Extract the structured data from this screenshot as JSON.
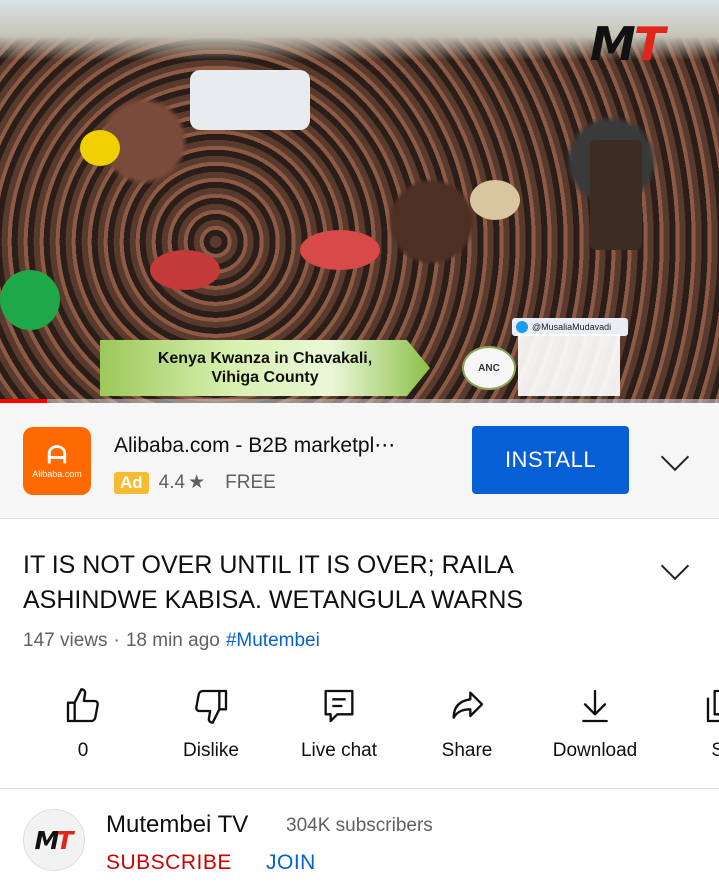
{
  "video": {
    "watermark_logo": "MT",
    "lower_third_line1": "Kenya Kwanza in Chavakali,",
    "lower_third_line2": "Vihiga County",
    "badge_text": "ANC",
    "handle": "@MusaliaMudavadi",
    "progress": 0.065
  },
  "ad": {
    "icon_brand": "Alibaba.com",
    "title": "Alibaba.com - B2B marketpl⋯",
    "badge": "Ad",
    "rating": "4.4",
    "price": "FREE",
    "install_label": "INSTALL"
  },
  "video_info": {
    "title": "IT IS NOT OVER UNTIL IT IS OVER; RAILA ASHINDWE KABISA. WETANGULA WARNS",
    "views": "147 views",
    "separator": "·",
    "age": "18 min ago",
    "hashtag": "#Mutembei"
  },
  "actions": [
    {
      "label": "0",
      "icon": "thumbs-up-icon"
    },
    {
      "label": "Dislike",
      "icon": "thumbs-down-icon"
    },
    {
      "label": "Live chat",
      "icon": "chat-icon"
    },
    {
      "label": "Share",
      "icon": "share-icon"
    },
    {
      "label": "Download",
      "icon": "download-icon"
    },
    {
      "label": "Sa",
      "icon": "save-icon"
    }
  ],
  "channel": {
    "name": "Mutembei TV",
    "subscribers": "304K subscribers",
    "subscribe_label": "SUBSCRIBE",
    "join_label": "JOIN"
  }
}
